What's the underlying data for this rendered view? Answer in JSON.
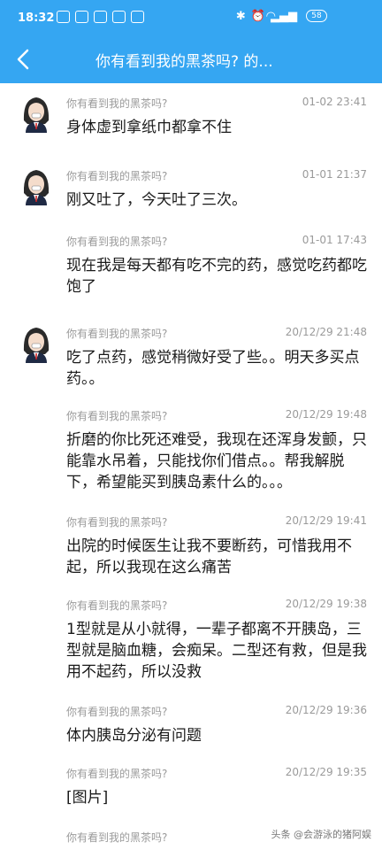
{
  "status": {
    "time": "18:32",
    "battery": "58"
  },
  "nav": {
    "title": "你有看到我的黑茶吗? 的..."
  },
  "messages": [
    {
      "sender": "你有看到我的黑茶吗?",
      "time": "01-02 23:41",
      "text": "身体虚到拿纸巾都拿不住"
    },
    {
      "sender": "你有看到我的黑茶吗?",
      "time": "01-01 21:37",
      "text": "刚又吐了，今天吐了三次。"
    },
    {
      "sender": "你有看到我的黑茶吗?",
      "time": "01-01 17:43",
      "text": "现在我是每天都有吃不完的药，感觉吃药都吃饱了"
    },
    {
      "sender": "你有看到我的黑茶吗?",
      "time": "20/12/29 21:48",
      "text": "吃了点药，感觉稍微好受了些。。明天多买点药。。"
    },
    {
      "sender": "你有看到我的黑茶吗?",
      "time": "20/12/29 19:48",
      "text": "折磨的你比死还难受，我现在还浑身发颤，只能靠水吊着，只能找你们借点。。帮我解脱下，希望能买到胰岛素什么的。。。"
    },
    {
      "sender": "你有看到我的黑茶吗?",
      "time": "20/12/29 19:41",
      "text": "出院的时候医生让我不要断药，可惜我用不起，所以我现在这么痛苦"
    },
    {
      "sender": "你有看到我的黑茶吗?",
      "time": "20/12/29 19:38",
      "text": "1型就是从小就得，一辈子都离不开胰岛，三型就是脑血糖，会痴呆。二型还有救，但是我用不起药，所以没救"
    },
    {
      "sender": "你有看到我的黑茶吗?",
      "time": "20/12/29 19:36",
      "text": "体内胰岛分泌有问题"
    },
    {
      "sender": "你有看到我的黑茶吗?",
      "time": "20/12/29 19:35",
      "text": "[图片]"
    },
    {
      "sender": "你有看到我的黑茶吗?",
      "time": "",
      "text": ""
    }
  ],
  "watermark": "头条 @会游泳的猪阿娱"
}
